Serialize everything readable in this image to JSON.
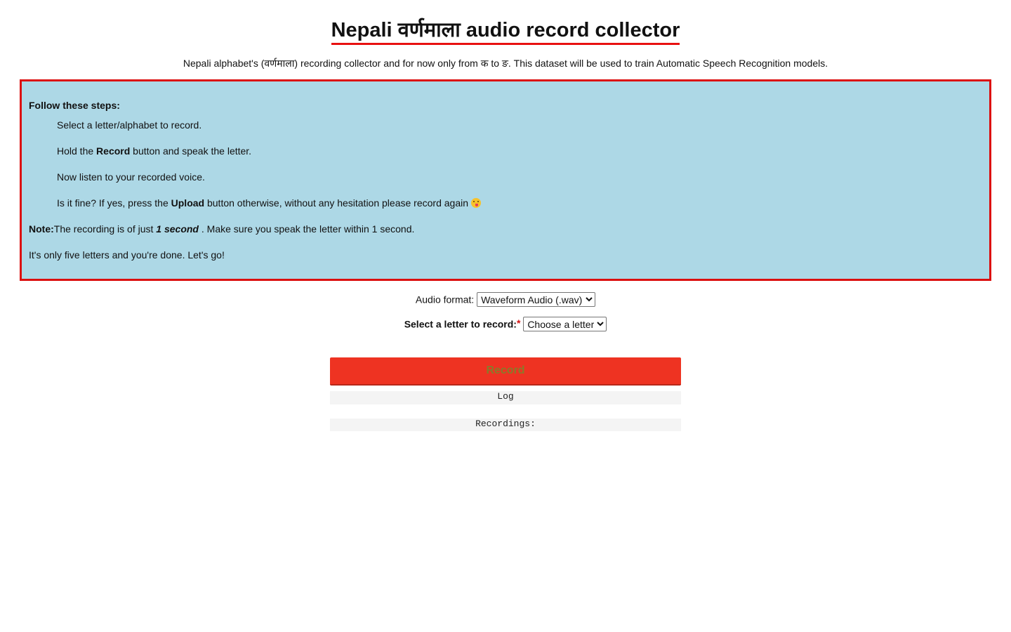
{
  "header": {
    "title": "Nepali वर्णमाला audio record collector",
    "subtitle": "Nepali alphabet's (वर्णमाला) recording collector and for now only from क to ङ. This dataset will be used to train Automatic Speech Recognition models."
  },
  "steps": {
    "heading": "Follow these steps:",
    "step1": "Select a letter/alphabet to record.",
    "step2_pre": "Hold the ",
    "step2_bold": "Record",
    "step2_post": " button and speak the letter.",
    "step3": "Now listen to your recorded voice.",
    "step4_pre": "Is it fine? If yes, press the ",
    "step4_bold": "Upload",
    "step4_post": " button otherwise, without any hesitation please record again ",
    "note_label": "Note:",
    "note_pre": "The recording is of just ",
    "note_em": "1 second",
    "note_post": " . Make sure you speak the letter within 1 second.",
    "final": "It's only five letters and you're done. Let's go!"
  },
  "form": {
    "audio_format_label": "Audio format:",
    "audio_format_selected": "Waveform Audio (.wav)",
    "letter_label": "Select a letter to record:",
    "required_mark": "*",
    "letter_selected": "Choose a letter"
  },
  "controls": {
    "record_label": "Record",
    "log_label": "Log",
    "recordings_label": "Recordings:"
  },
  "colors": {
    "box_bg": "#add8e6",
    "box_border": "#dc0f0f",
    "record_bg": "#ee3322",
    "title_underline": "#e81010"
  },
  "icons": {
    "emoji": "face-savoring-food-icon"
  }
}
